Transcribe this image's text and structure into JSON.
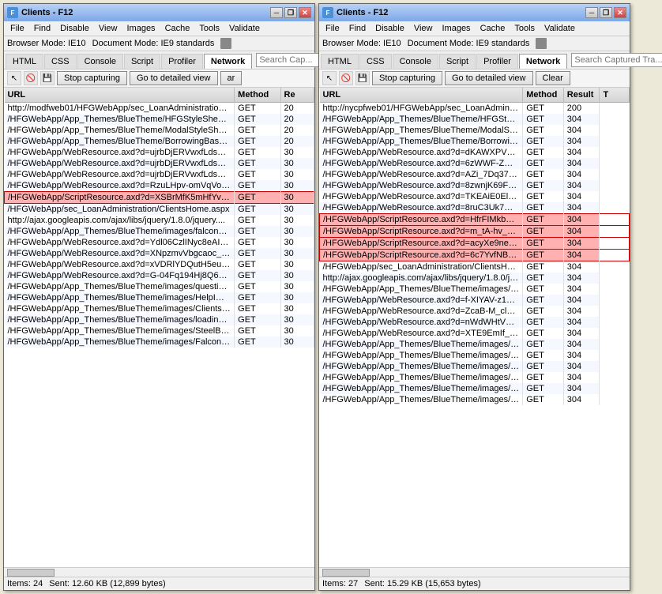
{
  "windows": [
    {
      "id": "left",
      "title": "Clients - F12",
      "menu": [
        "File",
        "Find",
        "Disable",
        "View",
        "Images",
        "Cache",
        "Tools",
        "Validate"
      ],
      "browser_mode": "Browser Mode: IE10",
      "doc_mode": "Document Mode: IE9 standards",
      "tabs": [
        "HTML",
        "CSS",
        "Console",
        "Script",
        "Profiler",
        "Network"
      ],
      "active_tab": "Network",
      "search_placeholder": "Search Cap...",
      "stop_btn": "Stop capturing",
      "detail_btn": "Go to detailed view",
      "clear_btn": "ar",
      "columns": [
        "URL",
        "Method",
        "Re"
      ],
      "rows": [
        {
          "url": "http://modfweb01/HFGWebApp/sec_LoanAdministration/Cli...",
          "method": "GET",
          "result": "20",
          "highlight": false
        },
        {
          "url": "/HFGWebApp/App_Themes/BlueTheme/HFGStyleSheet.css",
          "method": "GET",
          "result": "20",
          "highlight": false
        },
        {
          "url": "/HFGWebApp/App_Themes/BlueTheme/ModalStyleSheet.css",
          "method": "GET",
          "result": "20",
          "highlight": false
        },
        {
          "url": "/HFGWebApp/App_Themes/BlueTheme/BorrowingBase_Styl...",
          "method": "GET",
          "result": "20",
          "highlight": false
        },
        {
          "url": "/HFGWebApp/WebResource.axd?d=ujrbDjERVwxfLdsUpNN...",
          "method": "GET",
          "result": "30",
          "highlight": false
        },
        {
          "url": "/HFGWebApp/WebResource.axd?d=ujrbDjERVwxfLdsUpNN...",
          "method": "GET",
          "result": "30",
          "highlight": false
        },
        {
          "url": "/HFGWebApp/WebResource.axd?d=ujrbDjERVwxfLdsUpNN...",
          "method": "GET",
          "result": "30",
          "highlight": false
        },
        {
          "url": "/HFGWebApp/WebResource.axd?d=RzuLHpv-omVqVoomD...",
          "method": "GET",
          "result": "30",
          "highlight": false
        },
        {
          "url": "/HFGWebApp/ScriptResource.axd?d=XSBrMfK5mHfYvsSoM...",
          "method": "GET",
          "result": "30",
          "highlight": true
        },
        {
          "url": "/HFGWebApp/sec_LoanAdministration/ClientsHome.aspx",
          "method": "GET",
          "result": "30",
          "highlight": false
        },
        {
          "url": "http://ajax.googleapis.com/ajax/libs/jquery/1.8.0/jquery....",
          "method": "GET",
          "result": "30",
          "highlight": false
        },
        {
          "url": "/HFGWebApp/App_Themes/BlueTheme/images/falcon_fullt...",
          "method": "GET",
          "result": "30",
          "highlight": false
        },
        {
          "url": "/HFGWebApp/WebResource.axd?d=Ydl06CzlINyc8eAIu3nU...",
          "method": "GET",
          "result": "30",
          "highlight": false
        },
        {
          "url": "/HFGWebApp/WebResource.axd?d=XNpzmvVbgcaoc_filtBF...",
          "method": "GET",
          "result": "30",
          "highlight": false
        },
        {
          "url": "/HFGWebApp/WebResource.axd?d=xVDRlYDQutH5euTprw...",
          "method": "GET",
          "result": "30",
          "highlight": false
        },
        {
          "url": "/HFGWebApp/WebResource.axd?d=G-04Fq194Hj8Q6FjJxi...",
          "method": "GET",
          "result": "30",
          "highlight": false
        },
        {
          "url": "/HFGWebApp/App_Themes/BlueTheme/images/question_m...",
          "method": "GET",
          "result": "30",
          "highlight": false
        },
        {
          "url": "/HFGWebApp/App_Themes/BlueTheme/images/HelpImg.jpg",
          "method": "GET",
          "result": "30",
          "highlight": false
        },
        {
          "url": "/HFGWebApp/App_Themes/BlueTheme/images/Clients.jpg",
          "method": "GET",
          "result": "30",
          "highlight": false
        },
        {
          "url": "/HFGWebApp/App_Themes/BlueTheme/images/loading.gif",
          "method": "GET",
          "result": "30",
          "highlight": false
        },
        {
          "url": "/HFGWebApp/App_Themes/BlueTheme/images/SteelBlueGr...",
          "method": "GET",
          "result": "30",
          "highlight": false
        },
        {
          "url": "/HFGWebApp/App_Themes/BlueTheme/images/FalconBann...",
          "method": "GET",
          "result": "30",
          "highlight": false
        }
      ],
      "status_items": "Items: 24",
      "status_sent": "Sent: 12.60 KB (12,899 bytes)"
    },
    {
      "id": "right",
      "title": "Clients - F12",
      "menu": [
        "File",
        "Find",
        "Disable",
        "View",
        "Images",
        "Cache",
        "Tools",
        "Validate"
      ],
      "browser_mode": "Browser Mode: IE10",
      "doc_mode": "Document Mode: IE9 standards",
      "tabs": [
        "HTML",
        "CSS",
        "Console",
        "Script",
        "Profiler",
        "Network"
      ],
      "active_tab": "Network",
      "search_placeholder": "Search Captured Tra...",
      "stop_btn": "Stop capturing",
      "detail_btn": "Go to detailed view",
      "clear_btn": "Clear",
      "columns": [
        "URL",
        "Method",
        "Result",
        "T"
      ],
      "rows": [
        {
          "url": "http://nycpfweb01/HFGWebApp/sec_LoanAdministration/Cli...",
          "method": "GET",
          "result": "200",
          "highlight": false
        },
        {
          "url": "/HFGWebApp/App_Themes/BlueTheme/HFGStyleSheet.css?...",
          "method": "GET",
          "result": "304",
          "highlight": false
        },
        {
          "url": "/HFGWebApp/App_Themes/BlueTheme/ModalStyleSheet.css",
          "method": "GET",
          "result": "304",
          "highlight": false
        },
        {
          "url": "/HFGWebApp/App_Themes/BlueTheme/BorrowingBase_Styl...",
          "method": "GET",
          "result": "304",
          "highlight": false
        },
        {
          "url": "/HFGWebApp/WebResource.axd?d=dKAWXPV39KZntL1cwx...",
          "method": "GET",
          "result": "304",
          "highlight": false
        },
        {
          "url": "/HFGWebApp/WebResource.axd?d=6zWWF-ZWiHaEUndlkp...",
          "method": "GET",
          "result": "304",
          "highlight": false
        },
        {
          "url": "/HFGWebApp/WebResource.axd?d=AZi_7Dq374wsWy-K9w...",
          "method": "GET",
          "result": "304",
          "highlight": false
        },
        {
          "url": "/HFGWebApp/WebResource.axd?d=8zwnjK69Fn1oYAcG8zu...",
          "method": "GET",
          "result": "304",
          "highlight": false
        },
        {
          "url": "/HFGWebApp/WebResource.axd?d=TKEAiE0ElgcTPLxZNEx...",
          "method": "GET",
          "result": "304",
          "highlight": false
        },
        {
          "url": "/HFGWebApp/WebResource.axd?d=8ruC3Uk7GTGwvRe3ls...",
          "method": "GET",
          "result": "304",
          "highlight": false
        },
        {
          "url": "/HFGWebApp/ScriptResource.axd?d=HfrFIMkbORsTTqVYwv...",
          "method": "GET",
          "result": "304",
          "highlight": true
        },
        {
          "url": "/HFGWebApp/ScriptResource.axd?d=m_tA-hv_A5Ysm2M7...",
          "method": "GET",
          "result": "304",
          "highlight": true
        },
        {
          "url": "/HFGWebApp/ScriptResource.axd?d=acyXe9neu7e4NmAEri...",
          "method": "GET",
          "result": "304",
          "highlight": true
        },
        {
          "url": "/HFGWebApp/ScriptResource.axd?d=6c7YvfNB68GTnBOOn...",
          "method": "GET",
          "result": "304",
          "highlight": true
        },
        {
          "url": "/HFGWebApp/sec_LoanAdministration/ClientsHome.aspx?_T...",
          "method": "GET",
          "result": "304",
          "highlight": false
        },
        {
          "url": "http://ajax.googleapis.com/ajax/libs/jquery/1.8.0/jquery.mi...",
          "method": "GET",
          "result": "304",
          "highlight": false
        },
        {
          "url": "/HFGWebApp/App_Themes/BlueTheme/images/falcon_fullto...",
          "method": "GET",
          "result": "304",
          "highlight": false
        },
        {
          "url": "/HFGWebApp/WebResource.axd?d=f-XIYAV-z1vwpuLWzBm...",
          "method": "GET",
          "result": "304",
          "highlight": false
        },
        {
          "url": "/HFGWebApp/WebResource.axd?d=ZcaB-M_clkOnmSRiw20...",
          "method": "GET",
          "result": "304",
          "highlight": false
        },
        {
          "url": "/HFGWebApp/WebResource.axd?d=nWdWHtVX3DrnyteN0...",
          "method": "GET",
          "result": "304",
          "highlight": false
        },
        {
          "url": "/HFGWebApp/WebResource.axd?d=XTE9EmIf_NwfW3FFS_...",
          "method": "GET",
          "result": "304",
          "highlight": false
        },
        {
          "url": "/HFGWebApp/App_Themes/BlueTheme/images/question_ma...",
          "method": "GET",
          "result": "304",
          "highlight": false
        },
        {
          "url": "/HFGWebApp/App_Themes/BlueTheme/images/HelpImg.jpg",
          "method": "GET",
          "result": "304",
          "highlight": false
        },
        {
          "url": "/HFGWebApp/App_Themes/BlueTheme/images/Clients.jpg",
          "method": "GET",
          "result": "304",
          "highlight": false
        },
        {
          "url": "/HFGWebApp/App_Themes/BlueTheme/images/loading.gif",
          "method": "GET",
          "result": "304",
          "highlight": false
        },
        {
          "url": "/HFGWebApp/App_Themes/BlueTheme/images/SteelBlueGra...",
          "method": "GET",
          "result": "304",
          "highlight": false
        },
        {
          "url": "/HFGWebApp/App_Themes/BlueTheme/images/FalconBanne...",
          "method": "GET",
          "result": "304",
          "highlight": false
        }
      ],
      "status_items": "Items: 27",
      "status_sent": "Sent: 15.29 KB (15,653 bytes)"
    }
  ],
  "icons": {
    "cursor": "↖",
    "stop": "⛔",
    "save": "💾",
    "close": "✕",
    "minimize": "─",
    "maximize": "□",
    "restore": "❐"
  }
}
